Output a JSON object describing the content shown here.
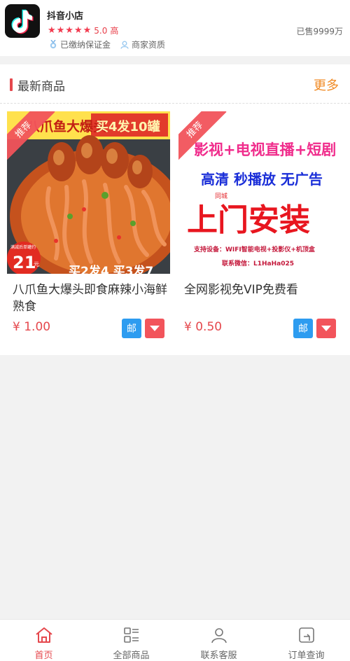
{
  "shop": {
    "name": "抖音小店",
    "stars": "★★★★★",
    "rating": "5.0",
    "rating_level": "高",
    "sold": "已售9999万",
    "badges": [
      {
        "label": "已缴纳保证金",
        "icon": "deposit-medal-icon"
      },
      {
        "label": "商家资质",
        "icon": "merchant-user-icon"
      }
    ]
  },
  "section": {
    "title": "最新商品",
    "more": "更多"
  },
  "products": [
    {
      "ribbon": "推荐",
      "title": "八爪鱼大爆头即食麻辣小海鲜熟食",
      "price": "¥ 1.00",
      "mail_label": "邮",
      "image": {
        "banner_left": "八爪鱼大爆头",
        "banner_right": "买4发10罐",
        "badge_small": "满减后单罐约",
        "badge_num": "21",
        "badge_unit": "元",
        "bottom": "买2发4 买3发7"
      }
    },
    {
      "ribbon": "推荐",
      "title": "全网影视免VIP免费看",
      "price": "¥ 0.50",
      "mail_label": "邮",
      "image": {
        "line1": "影视+电视直播+短剧",
        "line2": "高清 秒播放 无广告",
        "tag": "同城",
        "line3": "上门安装",
        "line4": "支持设备：WIFI智能电视+投影仪+机顶盒",
        "line5": "联系微信：L1HaHa025"
      }
    }
  ],
  "tabs": [
    {
      "label": "首页",
      "icon": "home-icon",
      "active": true
    },
    {
      "label": "全部商品",
      "icon": "list-icon",
      "active": false
    },
    {
      "label": "联系客服",
      "icon": "user-icon",
      "active": false
    },
    {
      "label": "订单查询",
      "icon": "order-icon",
      "active": false
    }
  ],
  "colors": {
    "accent": "#e5484d",
    "more": "#f08a24",
    "mail_button": "#2d9cf0",
    "ribbon": "#f2545b"
  }
}
